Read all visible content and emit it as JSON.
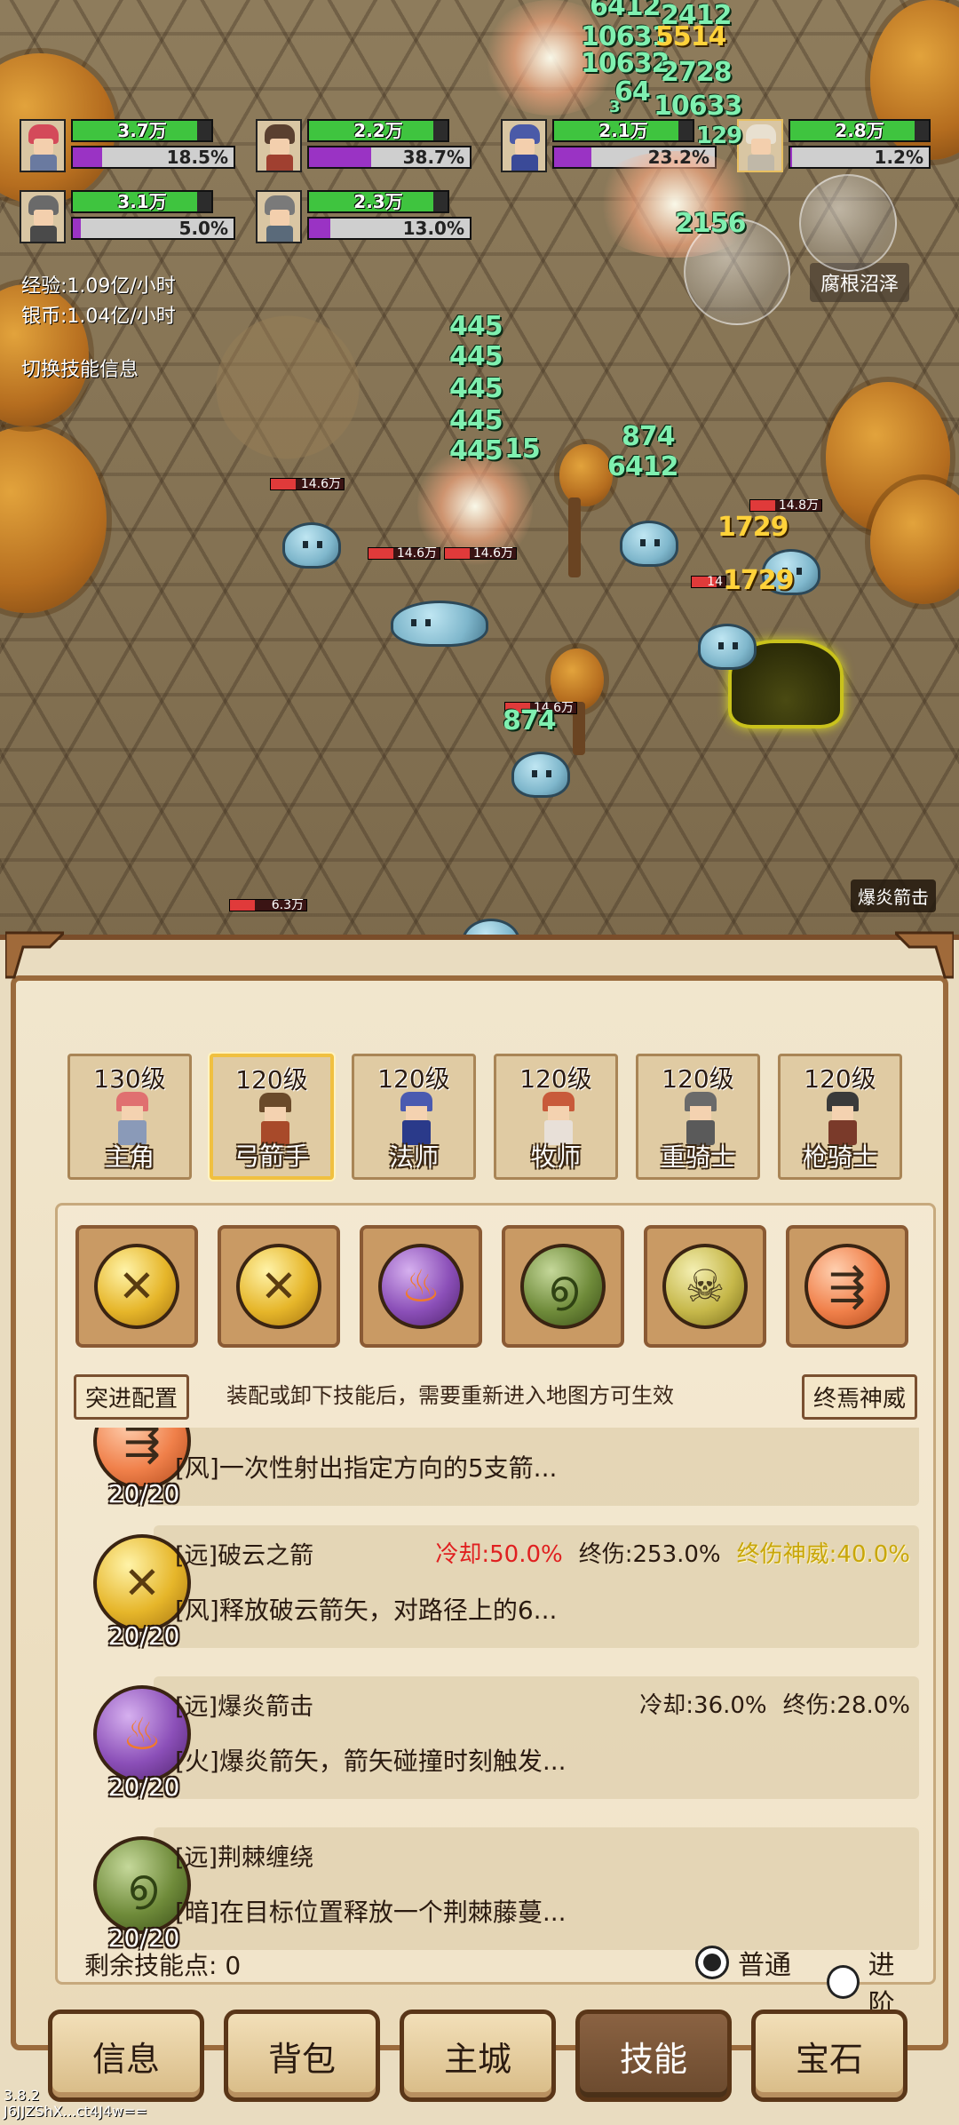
{
  "hud": {
    "party": [
      {
        "hp": "3.7万",
        "hp_frac": 0.9,
        "mp": "18.5%",
        "mp_frac": 0.185,
        "hair": "#d44a5a",
        "body": "#6a7aa0"
      },
      {
        "hp": "2.2万",
        "hp_frac": 0.9,
        "mp": "38.7%",
        "mp_frac": 0.387,
        "hair": "#5a4030",
        "body": "#a04030"
      },
      {
        "hp": "2.1万",
        "hp_frac": 0.9,
        "mp": "23.2%",
        "mp_frac": 0.232,
        "hair": "#4a5aa8",
        "body": "#3a4a98"
      },
      {
        "hp": "2.8万",
        "hp_frac": 0.9,
        "mp": "1.2%",
        "mp_frac": 0.012,
        "hair": "#e8e0d0",
        "body": "#c0b8a8"
      },
      {
        "hp": "3.1万",
        "hp_frac": 0.9,
        "mp": "5.0%",
        "mp_frac": 0.05,
        "hair": "#6a6a6a",
        "body": "#4a4a4a"
      },
      {
        "hp": "2.3万",
        "hp_frac": 0.9,
        "mp": "13.0%",
        "mp_frac": 0.13,
        "hair": "#7a7a7a",
        "body": "#5a6a7a"
      }
    ],
    "exp_rate": "经验:1.09亿/小时",
    "silver_rate": "银币:1.04亿/小时",
    "toggle_skill_info": "切换技能信息",
    "location": "腐根沼泽",
    "active_skill_banner": "爆炎箭击"
  },
  "battle": {
    "damage_numbers": [
      "6412",
      "2412",
      "10631",
      "5514",
      "10632",
      "2728",
      "64",
      "10633",
      "3",
      "129",
      "2156",
      "445",
      "445",
      "445",
      "445",
      "445",
      "15",
      "874",
      "6412",
      "1729",
      "1729",
      "874"
    ],
    "enemy_hp": [
      "14.6万",
      "14.6万",
      "14.6万",
      "14.8万",
      "14",
      "14.6万",
      "6.3万"
    ]
  },
  "heroes": [
    {
      "level": "130级",
      "name": "主角",
      "hair": "#e07070",
      "body": "#8a9ab8"
    },
    {
      "level": "120级",
      "name": "弓箭手",
      "hair": "#6a4a2a",
      "body": "#a84a2a"
    },
    {
      "level": "120级",
      "name": "法师",
      "hair": "#4a5ab0",
      "body": "#2a3a8a"
    },
    {
      "level": "120级",
      "name": "牧师",
      "hair": "#c85a3a",
      "body": "#e8e0d8"
    },
    {
      "level": "120级",
      "name": "重骑士",
      "hair": "#6a6a6a",
      "body": "#5a5a5a"
    },
    {
      "level": "120级",
      "name": "枪骑士",
      "hair": "#3a3a3a",
      "body": "#7a3a2a"
    }
  ],
  "equipped_skills": [
    {
      "icon": "crossed-arrows-icon",
      "style": "gold",
      "glyph": "✕"
    },
    {
      "icon": "crossed-arrows-icon",
      "style": "gold",
      "glyph": "✕"
    },
    {
      "icon": "flame-arrow-icon",
      "style": "purple",
      "glyph": "♨"
    },
    {
      "icon": "thorn-vine-icon",
      "style": "green",
      "glyph": "൭"
    },
    {
      "icon": "skull-icon",
      "style": "olive",
      "glyph": "☠"
    },
    {
      "icon": "arrows-icon",
      "style": "orange",
      "glyph": "⇶"
    }
  ],
  "config": {
    "left_button": "突进配置",
    "hint": "装配或卸下技能后，需要重新进入地图方可生效",
    "right_button": "终焉神威"
  },
  "skill_list": [
    {
      "icon": "arrows-icon",
      "style": "orange",
      "glyph": "⇶",
      "count": "20/20",
      "title": "",
      "desc": "[风]一次性射出指定方向的5支箭...",
      "stats": []
    },
    {
      "icon": "crossed-arrows-icon",
      "style": "gold",
      "glyph": "✕",
      "count": "20/20",
      "title": "[远]破云之箭",
      "desc": "[风]释放破云箭矢，对路径上的6...",
      "stats": [
        {
          "text": "冷却:50.0%",
          "color": "red"
        },
        {
          "text": "终伤:253.0%",
          "color": "dark"
        },
        {
          "text": "终伤神威:40.0%",
          "color": "yellow"
        }
      ]
    },
    {
      "icon": "flame-arrow-icon",
      "style": "purple",
      "glyph": "♨",
      "count": "20/20",
      "title": "[远]爆炎箭击",
      "desc": "[火]爆炎箭矢，箭矢碰撞时刻触发...",
      "stats": [
        {
          "text": "冷却:36.0%",
          "color": "dark"
        },
        {
          "text": "终伤:28.0%",
          "color": "dark"
        }
      ]
    },
    {
      "icon": "thorn-vine-icon",
      "style": "green",
      "glyph": "൭",
      "count": "20/20",
      "title": "[远]荆棘缠绕",
      "desc": "[暗]在目标位置释放一个荆棘藤蔓...",
      "stats": []
    }
  ],
  "footer": {
    "remaining_points": "剩余技能点:  0",
    "mode_normal": "普通",
    "mode_advanced": "进阶"
  },
  "nav": {
    "tabs": [
      "信息",
      "背包",
      "主城",
      "技能",
      "宝石"
    ],
    "active_index": 3
  },
  "version": {
    "number": "3.8.2",
    "id": "J6JJZShX...ct4J4w=="
  }
}
